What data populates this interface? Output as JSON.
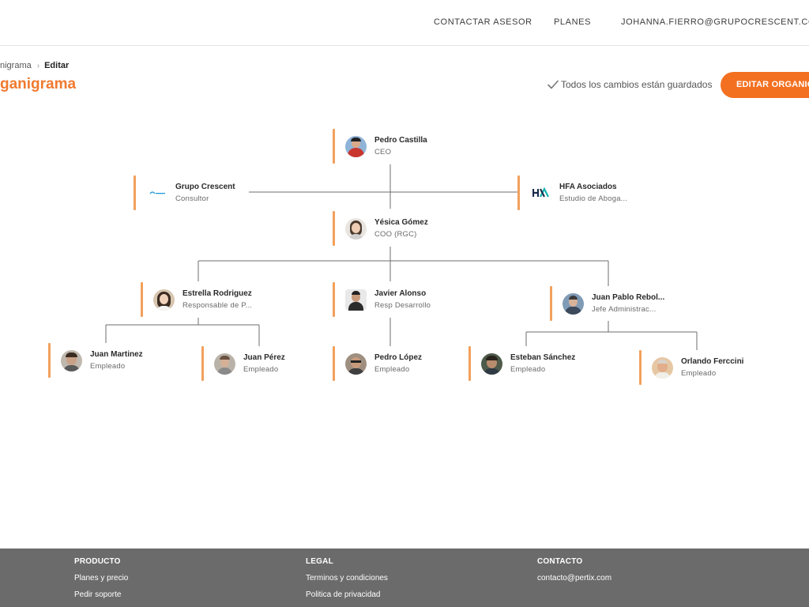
{
  "nav": {
    "contact_advisor": "CONTACTAR ASESOR",
    "plans": "PLANES",
    "user_email": "JOHANNA.FIERRO@GRUPOCRESCENT.COM.AR"
  },
  "breadcrumb": {
    "parent": "nigrama",
    "current": "Editar"
  },
  "page": {
    "title": "ganigrama",
    "saved_status": "Todos los cambios están guardados",
    "edit_button": "EDITAR ORGANIGRAMA"
  },
  "org": {
    "ceo": {
      "name": "Pedro Castilla",
      "role": "CEO"
    },
    "advisor_left": {
      "name": "Grupo Crescent",
      "role": "Consultor"
    },
    "advisor_right": {
      "name": "HFA Asociados",
      "role": "Estudio de Aboga..."
    },
    "coo": {
      "name": "Yésica Gómez",
      "role": "COO (RGC)"
    },
    "managers": [
      {
        "name": "Estrella Rodriguez",
        "role": "Responsable de P..."
      },
      {
        "name": "Javier Alonso",
        "role": "Resp Desarrollo"
      },
      {
        "name": "Juan Pablo Rebol...",
        "role": "Jefe Administrac..."
      }
    ],
    "staff": [
      {
        "name": "Juan Martinez",
        "role": "Empleado"
      },
      {
        "name": "Juan Pérez",
        "role": "Empleado"
      },
      {
        "name": "Pedro López",
        "role": "Empleado"
      },
      {
        "name": "Esteban Sánchez",
        "role": "Empleado"
      },
      {
        "name": "Orlando Ferccini",
        "role": "Empleado"
      }
    ]
  },
  "footer": {
    "product": {
      "title": "PRODUCTO",
      "links": [
        "Planes y precio",
        "Pedir soporte"
      ]
    },
    "legal": {
      "title": "LEGAL",
      "links": [
        "Terminos y condiciones",
        "Politica de privacidad"
      ]
    },
    "contact": {
      "title": "CONTACTO",
      "links": [
        "contacto@pertix.com"
      ]
    }
  },
  "colors": {
    "accent": "#f37021",
    "node_bar": "#f2a05c",
    "footer_bg": "#6b6b6b",
    "title": "#f07a2e"
  }
}
